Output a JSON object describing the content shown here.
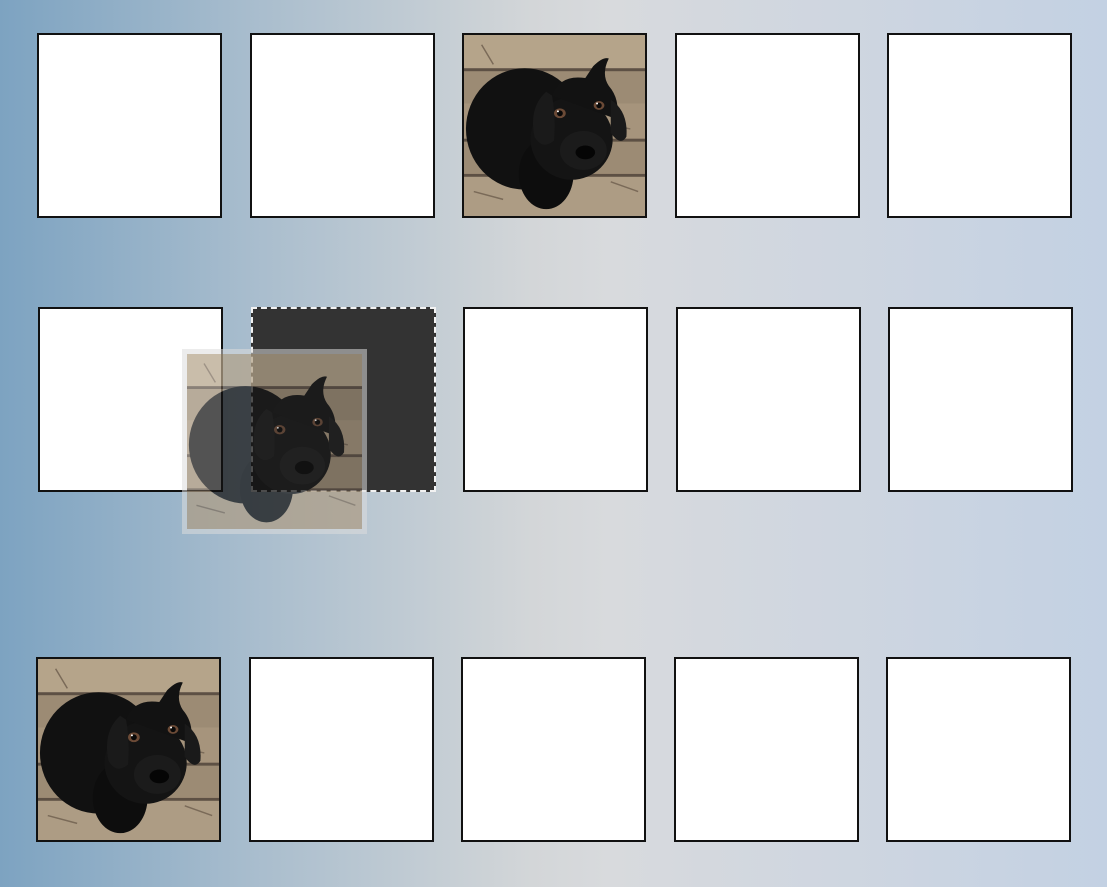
{
  "board": {
    "background_colors": [
      "#7da3c1",
      "#d8dadd",
      "#c3d1e3"
    ],
    "rows": [
      {
        "cells": [
          {
            "content": "empty"
          },
          {
            "content": "empty"
          },
          {
            "content": "dog-photo"
          },
          {
            "content": "empty"
          },
          {
            "content": "empty"
          }
        ]
      },
      {
        "cells": [
          {
            "content": "empty"
          },
          {
            "content": "drop-target"
          },
          {
            "content": "empty"
          },
          {
            "content": "empty"
          },
          {
            "content": "empty"
          }
        ]
      },
      {
        "cells": [
          {
            "content": "dog-photo"
          },
          {
            "content": "empty"
          },
          {
            "content": "empty"
          },
          {
            "content": "empty"
          },
          {
            "content": "empty"
          }
        ]
      }
    ],
    "drag_ghost": {
      "content": "dog-photo",
      "state": "dragging"
    },
    "icons": {
      "photo": "black-puppy-photo-icon"
    }
  }
}
